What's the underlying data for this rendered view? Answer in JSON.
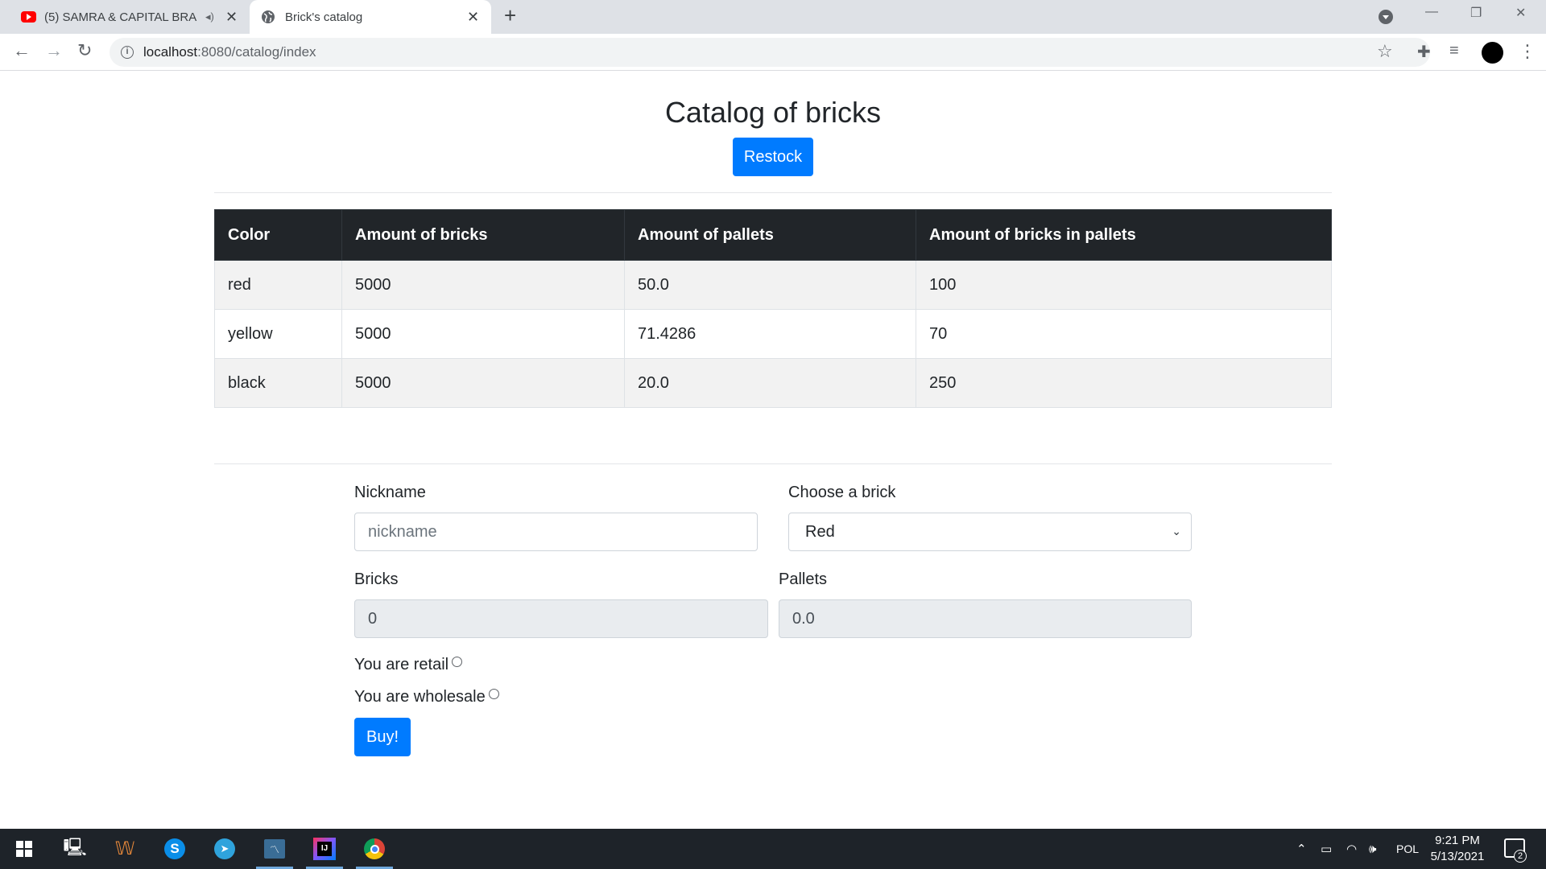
{
  "browser": {
    "tabs": [
      {
        "title": "(5) SAMRA & CAPITAL BRA -",
        "active": false,
        "icon": "youtube-icon"
      },
      {
        "title": "Brick's catalog",
        "active": true,
        "icon": "globe-icon"
      }
    ],
    "url_host": "localhost",
    "url_rest": ":8080/catalog/index"
  },
  "page": {
    "title": "Catalog of bricks",
    "restock_label": "Restock"
  },
  "table": {
    "headers": [
      "Color",
      "Amount of bricks",
      "Amount of pallets",
      "Amount of bricks in pallets"
    ],
    "rows": [
      [
        "red",
        "5000",
        "50.0",
        "100"
      ],
      [
        "yellow",
        "5000",
        "71.4286",
        "70"
      ],
      [
        "black",
        "5000",
        "20.0",
        "250"
      ]
    ]
  },
  "form": {
    "nickname_label": "Nickname",
    "nickname_placeholder": "nickname",
    "brick_label": "Choose a brick",
    "brick_selected": "Red",
    "bricks_label": "Bricks",
    "bricks_value": "0",
    "pallets_label": "Pallets",
    "pallets_value": "0.0",
    "retail_label": "You are retail",
    "wholesale_label": "You are wholesale",
    "buy_label": "Buy!"
  },
  "taskbar": {
    "language": "POL",
    "time": "9:21 PM",
    "date": "5/13/2021",
    "notification_count": "2"
  },
  "colors": {
    "primary": "#007bff",
    "table_header_bg": "#212529",
    "stripe": "#f2f2f2"
  }
}
